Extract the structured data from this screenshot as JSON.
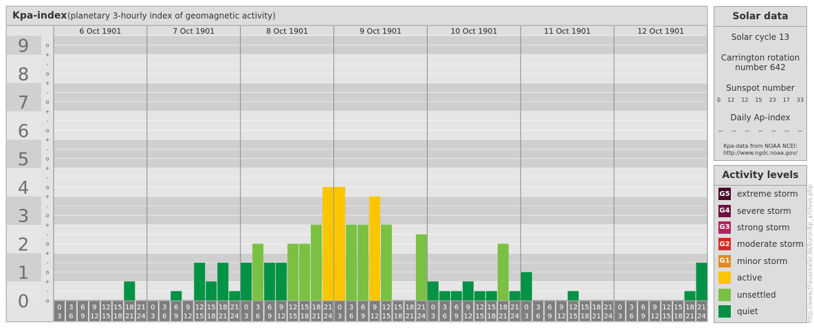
{
  "header": {
    "title": "Kpa-index",
    "subtitle": "(planetary 3-hourly index of geomagnetic activity)"
  },
  "colors": {
    "quiet": "#009245",
    "unsettled": "#7ac143",
    "active": "#fbc600",
    "minor_storm": "#e38a1e",
    "moderate_storm": "#d52a21",
    "strong_storm": "#b4215b",
    "severe_storm": "#6b1040",
    "extreme_storm": "#4a0a2a"
  },
  "chart_data": {
    "type": "bar",
    "title": "Kpa-index",
    "subtitle": "(planetary 3-hourly index of geomagnetic activity)",
    "ylim": [
      0,
      9.33
    ],
    "y_ticks": [
      "0",
      "1",
      "2",
      "3",
      "4",
      "5",
      "6",
      "7",
      "8",
      "9"
    ],
    "sub_tick_labels": [
      "o",
      "-",
      "+",
      "o",
      "-",
      "+",
      "o",
      "-",
      "+",
      "o",
      "-",
      "+",
      "o",
      "-",
      "+",
      "o",
      "-",
      "+",
      "o",
      "-",
      "+",
      "o",
      "-",
      "+",
      "o",
      "-",
      "+",
      "o"
    ],
    "days": [
      "6 Oct 1901",
      "7 Oct 1901",
      "8 Oct 1901",
      "9 Oct 1901",
      "10 Oct 1901",
      "11 Oct 1901",
      "12 Oct 1901"
    ],
    "interval_top": [
      "0",
      "3",
      "6",
      "9",
      "12",
      "15",
      "18",
      "21"
    ],
    "interval_bottom": [
      "3",
      "6",
      "9",
      "12",
      "15",
      "18",
      "21",
      "24"
    ],
    "values": [
      0,
      0,
      0,
      0,
      0,
      0,
      0.67,
      0,
      0,
      0,
      0.33,
      0,
      1.33,
      0.67,
      1.33,
      0.33,
      1.33,
      2,
      1.33,
      1.33,
      2,
      2,
      2.67,
      4,
      4,
      2.67,
      2.67,
      3.67,
      2.67,
      0,
      0,
      2.33,
      0.67,
      0.33,
      0.33,
      0.67,
      0.33,
      0.33,
      2,
      0.33,
      1,
      0,
      0,
      0,
      0.33,
      0,
      0,
      0,
      0,
      0,
      0,
      0,
      0,
      0,
      0.33,
      1.33
    ],
    "levels": [
      "quiet",
      "quiet",
      "quiet",
      "quiet",
      "quiet",
      "quiet",
      "quiet",
      "quiet",
      "quiet",
      "quiet",
      "quiet",
      "quiet",
      "quiet",
      "quiet",
      "quiet",
      "quiet",
      "quiet",
      "unsettled",
      "quiet",
      "quiet",
      "unsettled",
      "unsettled",
      "unsettled",
      "active",
      "active",
      "unsettled",
      "unsettled",
      "active",
      "unsettled",
      "quiet",
      "quiet",
      "unsettled",
      "quiet",
      "quiet",
      "quiet",
      "quiet",
      "quiet",
      "quiet",
      "unsettled",
      "quiet",
      "quiet",
      "quiet",
      "quiet",
      "quiet",
      "quiet",
      "quiet",
      "quiet",
      "quiet",
      "quiet",
      "quiet",
      "quiet",
      "quiet",
      "quiet",
      "quiet",
      "quiet",
      "quiet"
    ]
  },
  "solar": {
    "title": "Solar data",
    "cycle": "Solar cycle 13",
    "carrington_1": "Carrington rotation",
    "carrington_2": "number 642",
    "sunspot_title": "Sunspot number",
    "sunspot_values": [
      "0",
      "12",
      "12",
      "15",
      "23",
      "17",
      "33"
    ],
    "ap_title": "Daily Ap-index",
    "ap_values": [
      "--",
      "--",
      "--",
      "--",
      "--",
      "--",
      "--"
    ],
    "source_1": "Kpa-data from NOAA NCEI:",
    "source_2": "http://www.ngdc.noaa.gov/"
  },
  "activity": {
    "title": "Activity levels",
    "levels": [
      {
        "badge": "G5",
        "label": "extreme storm",
        "color": "#4a0a2a"
      },
      {
        "badge": "G4",
        "label": "severe storm",
        "color": "#6b1040"
      },
      {
        "badge": "G3",
        "label": "strong storm",
        "color": "#b4215b"
      },
      {
        "badge": "G2",
        "label": "moderate storm",
        "color": "#d52a21"
      },
      {
        "badge": "G1",
        "label": "minor storm",
        "color": "#e38a1e"
      },
      {
        "badge": "",
        "label": "active",
        "color": "#fbc600"
      },
      {
        "badge": "",
        "label": "unsettled",
        "color": "#7ac143"
      },
      {
        "badge": "",
        "label": "quiet",
        "color": "#009245"
      }
    ]
  },
  "watermark": "http://www.theusrealer.de/kurzr/kp_archive.php"
}
